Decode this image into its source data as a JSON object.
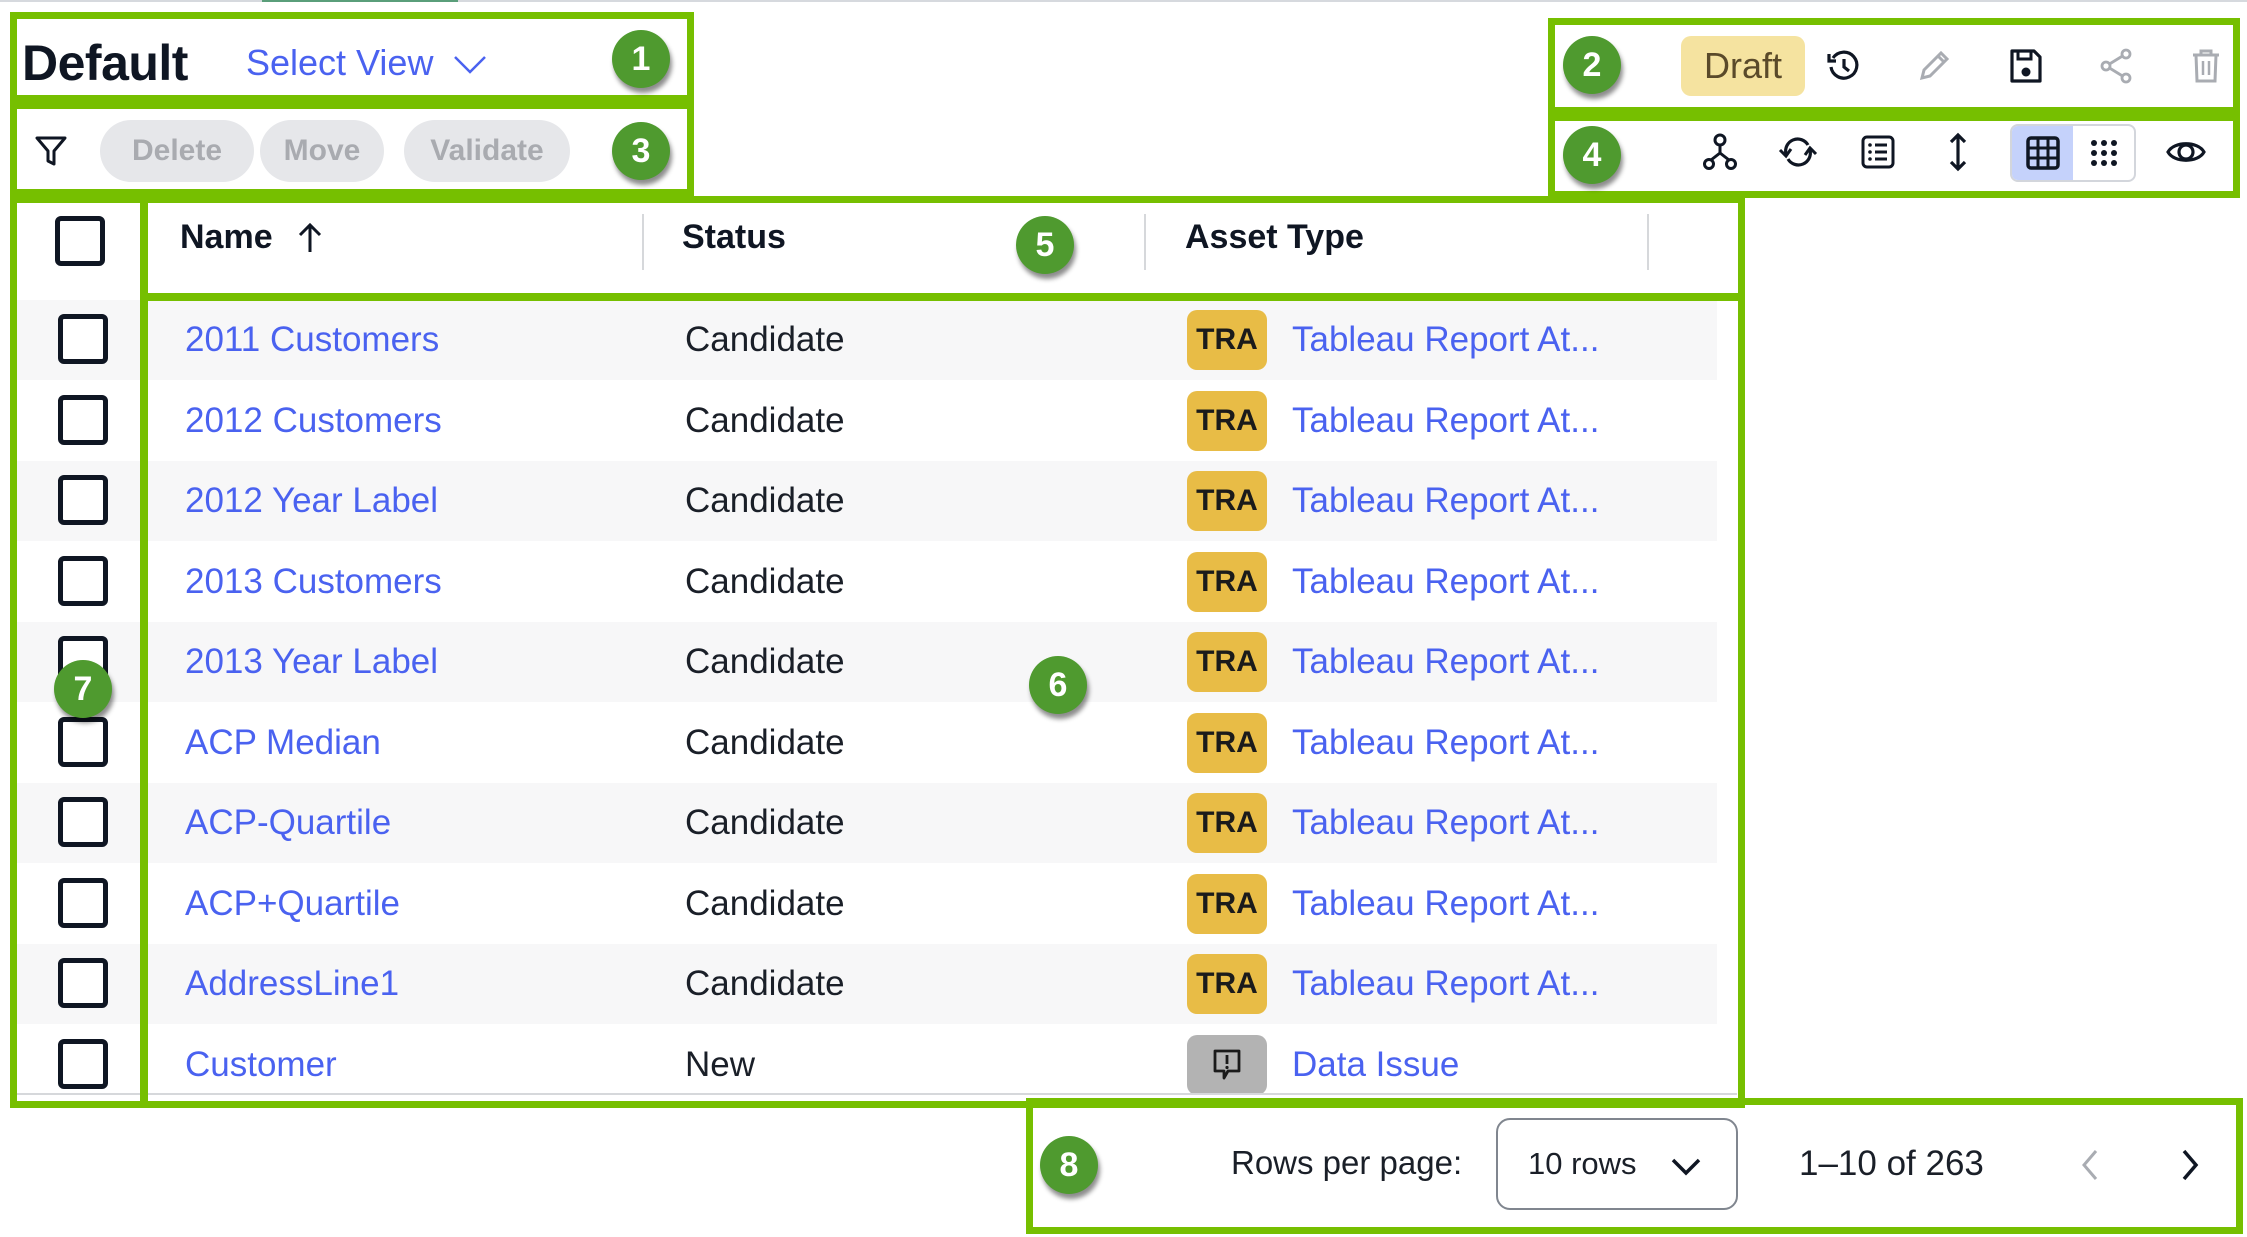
{
  "header": {
    "view_title": "Default",
    "select_view_label": "Select View"
  },
  "actions": {
    "filter_icon": "filter-icon",
    "delete_label": "Delete",
    "move_label": "Move",
    "validate_label": "Validate"
  },
  "toolbar": {
    "status_badge": "Draft",
    "icons": [
      "history-icon",
      "edit-icon",
      "save-icon",
      "share-icon",
      "delete-icon"
    ]
  },
  "view_toolbar": {
    "icons": [
      "hierarchy-icon",
      "sync-icon",
      "list-icon",
      "row-height-icon",
      "grid-view-icon",
      "compact-grid-icon",
      "visibility-icon"
    ],
    "active_view": "grid"
  },
  "table": {
    "columns": [
      {
        "label": "Name",
        "sort": "ascending"
      },
      {
        "label": "Status"
      },
      {
        "label": "Asset Type"
      }
    ],
    "rows": [
      {
        "name": "2011 Customers",
        "status": "Candidate",
        "badge": "TRA",
        "asset_type": "Tableau Report At..."
      },
      {
        "name": "2012 Customers",
        "status": "Candidate",
        "badge": "TRA",
        "asset_type": "Tableau Report At..."
      },
      {
        "name": "2012 Year Label",
        "status": "Candidate",
        "badge": "TRA",
        "asset_type": "Tableau Report At..."
      },
      {
        "name": "2013 Customers",
        "status": "Candidate",
        "badge": "TRA",
        "asset_type": "Tableau Report At..."
      },
      {
        "name": "2013 Year Label",
        "status": "Candidate",
        "badge": "TRA",
        "asset_type": "Tableau Report At..."
      },
      {
        "name": "ACP Median",
        "status": "Candidate",
        "badge": "TRA",
        "asset_type": "Tableau Report At..."
      },
      {
        "name": "ACP-Quartile",
        "status": "Candidate",
        "badge": "TRA",
        "asset_type": "Tableau Report At..."
      },
      {
        "name": "ACP+Quartile",
        "status": "Candidate",
        "badge": "TRA",
        "asset_type": "Tableau Report At..."
      },
      {
        "name": "AddressLine1",
        "status": "Candidate",
        "badge": "TRA",
        "asset_type": "Tableau Report At..."
      },
      {
        "name": "Customer",
        "status": "New",
        "badge": "data-issue-icon",
        "asset_type": "Data Issue"
      }
    ]
  },
  "pagination": {
    "rows_per_page_label": "Rows per page:",
    "rows_per_page_value": "10 rows",
    "range_text": "1–10 of 263"
  },
  "callouts": [
    "1",
    "2",
    "3",
    "4",
    "5",
    "6",
    "7",
    "8"
  ],
  "colors": {
    "accent_link": "#4a62f0",
    "highlight_border": "#76bf00",
    "callout_fill": "#4f9a2f",
    "badge_tra": "#e8bc46",
    "badge_issue": "#b3b3b3",
    "draft_bg": "#f5e3a0",
    "active_toggle": "#c5d2fb"
  }
}
